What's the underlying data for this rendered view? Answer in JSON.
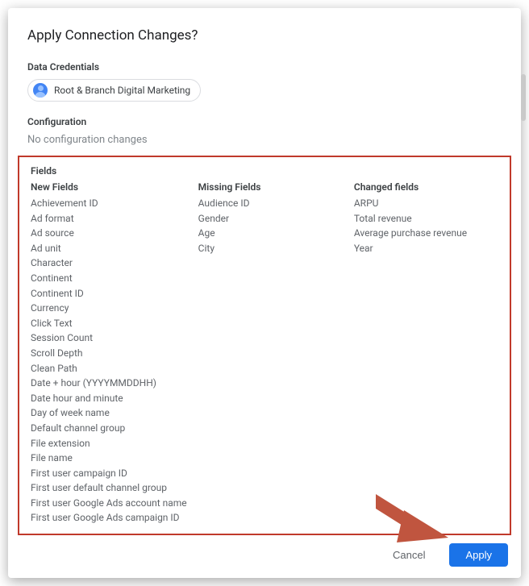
{
  "dialog": {
    "title": "Apply Connection Changes?"
  },
  "credentials": {
    "label": "Data Credentials",
    "chip": "Root & Branch Digital Marketing"
  },
  "configuration": {
    "label": "Configuration",
    "text": "No configuration changes"
  },
  "fields": {
    "label": "Fields",
    "columns": {
      "new": {
        "title": "New Fields",
        "items": [
          "Achievement ID",
          "Ad format",
          "Ad source",
          "Ad unit",
          "Character",
          "Continent",
          "Continent ID",
          "Currency",
          "Click Text",
          "Session Count",
          "Scroll Depth",
          "Clean Path",
          "Date + hour (YYYYMMDDHH)",
          "Date hour and minute",
          "Day of week name",
          "Default channel group",
          "File extension",
          "File name",
          "First user campaign ID",
          "First user default channel group",
          "First user Google Ads account name",
          "First user Google Ads campaign ID"
        ]
      },
      "missing": {
        "title": "Missing Fields",
        "items": [
          "Audience ID",
          "Gender",
          "Age",
          "City"
        ]
      },
      "changed": {
        "title": "Changed fields",
        "items": [
          "ARPU",
          "Total revenue",
          "Average purchase revenue",
          "Year"
        ]
      }
    }
  },
  "buttons": {
    "cancel": "Cancel",
    "apply": "Apply"
  },
  "annotation": {
    "arrow_color": "#c0553f",
    "highlight_color": "#c0392b"
  }
}
